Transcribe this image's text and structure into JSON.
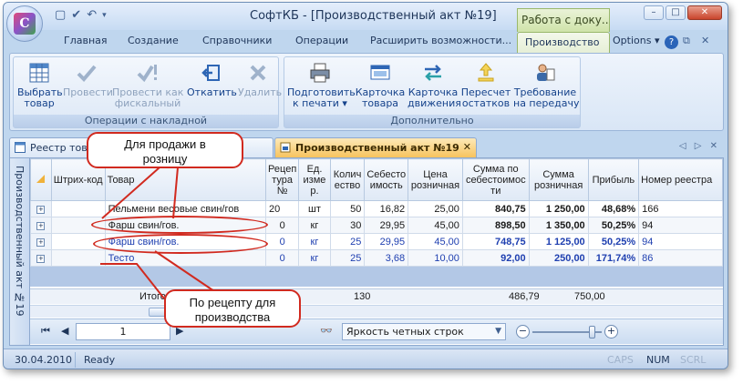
{
  "window": {
    "title": "СофтКБ - [Производственный акт №19]",
    "context_title": "Работа с доку...",
    "min_glyph": "–",
    "max_glyph": "□",
    "close_glyph": "✕"
  },
  "ribbon_tabs": [
    "Главная",
    "Создание",
    "Справочники",
    "Операции",
    "Расширить возможности...",
    "Производство"
  ],
  "options_label": "Options",
  "help_glyph": "?",
  "ribbon": {
    "group1": {
      "label": "Операции с накладной",
      "buttons": [
        {
          "label": "Выбрать\nтовар",
          "icon": "table-icon",
          "disabled": false
        },
        {
          "label": "Провести",
          "icon": "check-icon",
          "disabled": true
        },
        {
          "label": "Провести как\nфискальный",
          "icon": "check-exclaim-icon",
          "disabled": true
        },
        {
          "label": "Откатить",
          "icon": "undo-icon",
          "disabled": false
        },
        {
          "label": "Удалить",
          "icon": "delete-icon",
          "disabled": true
        }
      ]
    },
    "group2": {
      "label": "Дополнительно",
      "buttons": [
        {
          "label": "Подготовить\nк печати ▾",
          "icon": "printer-icon"
        },
        {
          "label": "Карточка\nтовара",
          "icon": "product-card-icon"
        },
        {
          "label": "Карточка\nдвижения",
          "icon": "transfer-arrows-icon"
        },
        {
          "label": "Пересчет\nостатков",
          "icon": "recalc-icon"
        },
        {
          "label": "Требование\nна передачу",
          "icon": "request-icon"
        }
      ]
    }
  },
  "doc_tabs": {
    "inactive": "Реестр тов...",
    "active": "Производственный акт №19",
    "close_glyph": "✕",
    "nav_glyphs": "◁ ▷ ✕"
  },
  "side_label": "Производственный акт №19",
  "table": {
    "headers": [
      "",
      "Штрих-код",
      "Товар",
      "Рецеп\nтура\n№",
      "Ед.\nизме\nр.",
      "Колич\nество",
      "Себесто\nимость",
      "Цена\nрозничная",
      "Сумма по\nсебестоимос\nти",
      "Сумма\nрозничная",
      "Прибыль",
      "Номер реестра"
    ],
    "rows": [
      {
        "barcode": "",
        "product": "Пельмени весовые свин/гов",
        "recipe": "20",
        "unit": "шт",
        "qty": "50",
        "cost": "16,82",
        "price": "25,00",
        "sum_cost": "840,75",
        "sum_retail": "1 250,00",
        "profit": "48,68%",
        "registry": "166",
        "blue": false
      },
      {
        "barcode": "",
        "product": "Фарш свин/гов.",
        "recipe": "0",
        "unit": "кг",
        "qty": "30",
        "cost": "29,95",
        "price": "45,00",
        "sum_cost": "898,50",
        "sum_retail": "1 350,00",
        "profit": "50,25%",
        "registry": "94",
        "blue": false
      },
      {
        "barcode": "",
        "product": "Фарш свин/гов.",
        "recipe": "0",
        "unit": "кг",
        "qty": "25",
        "cost": "29,95",
        "price": "45,00",
        "sum_cost": "748,75",
        "sum_retail": "1 125,00",
        "profit": "50,25%",
        "registry": "94",
        "blue": true
      },
      {
        "barcode": "",
        "product": "Тесто",
        "recipe": "0",
        "unit": "кг",
        "qty": "25",
        "cost": "3,68",
        "price": "10,00",
        "sum_cost": "92,00",
        "sum_retail": "250,00",
        "profit": "171,74%",
        "registry": "86",
        "blue": true
      }
    ],
    "expand_glyph": "+",
    "totals": {
      "label": "Итого:",
      "qty": "130",
      "sum_cost": "486,79",
      "sum_retail": "750,00"
    }
  },
  "navigator": {
    "page": "1",
    "row_style": "Яркость четных строк",
    "first_glyph": "⏮",
    "prev_glyph": "◀",
    "next_glyph": "▶",
    "binoculars_glyph": "👓",
    "dropdown_glyph": "▼",
    "zoom_out": "−",
    "zoom_in": "+"
  },
  "zoom_level": 0.85,
  "statusbar": {
    "date": "30.04.2010",
    "state": "Ready",
    "caps": "CAPS",
    "num": "NUM",
    "scrl": "SCRL"
  },
  "callouts": {
    "retail": "Для продажи в\nрозницу",
    "production": "По рецепту для\nпроизводства"
  },
  "colors": {
    "accent_red": "#d12a1f",
    "active_doc_tab": "#f7c35e",
    "value_blue": "#1e3fb0"
  }
}
